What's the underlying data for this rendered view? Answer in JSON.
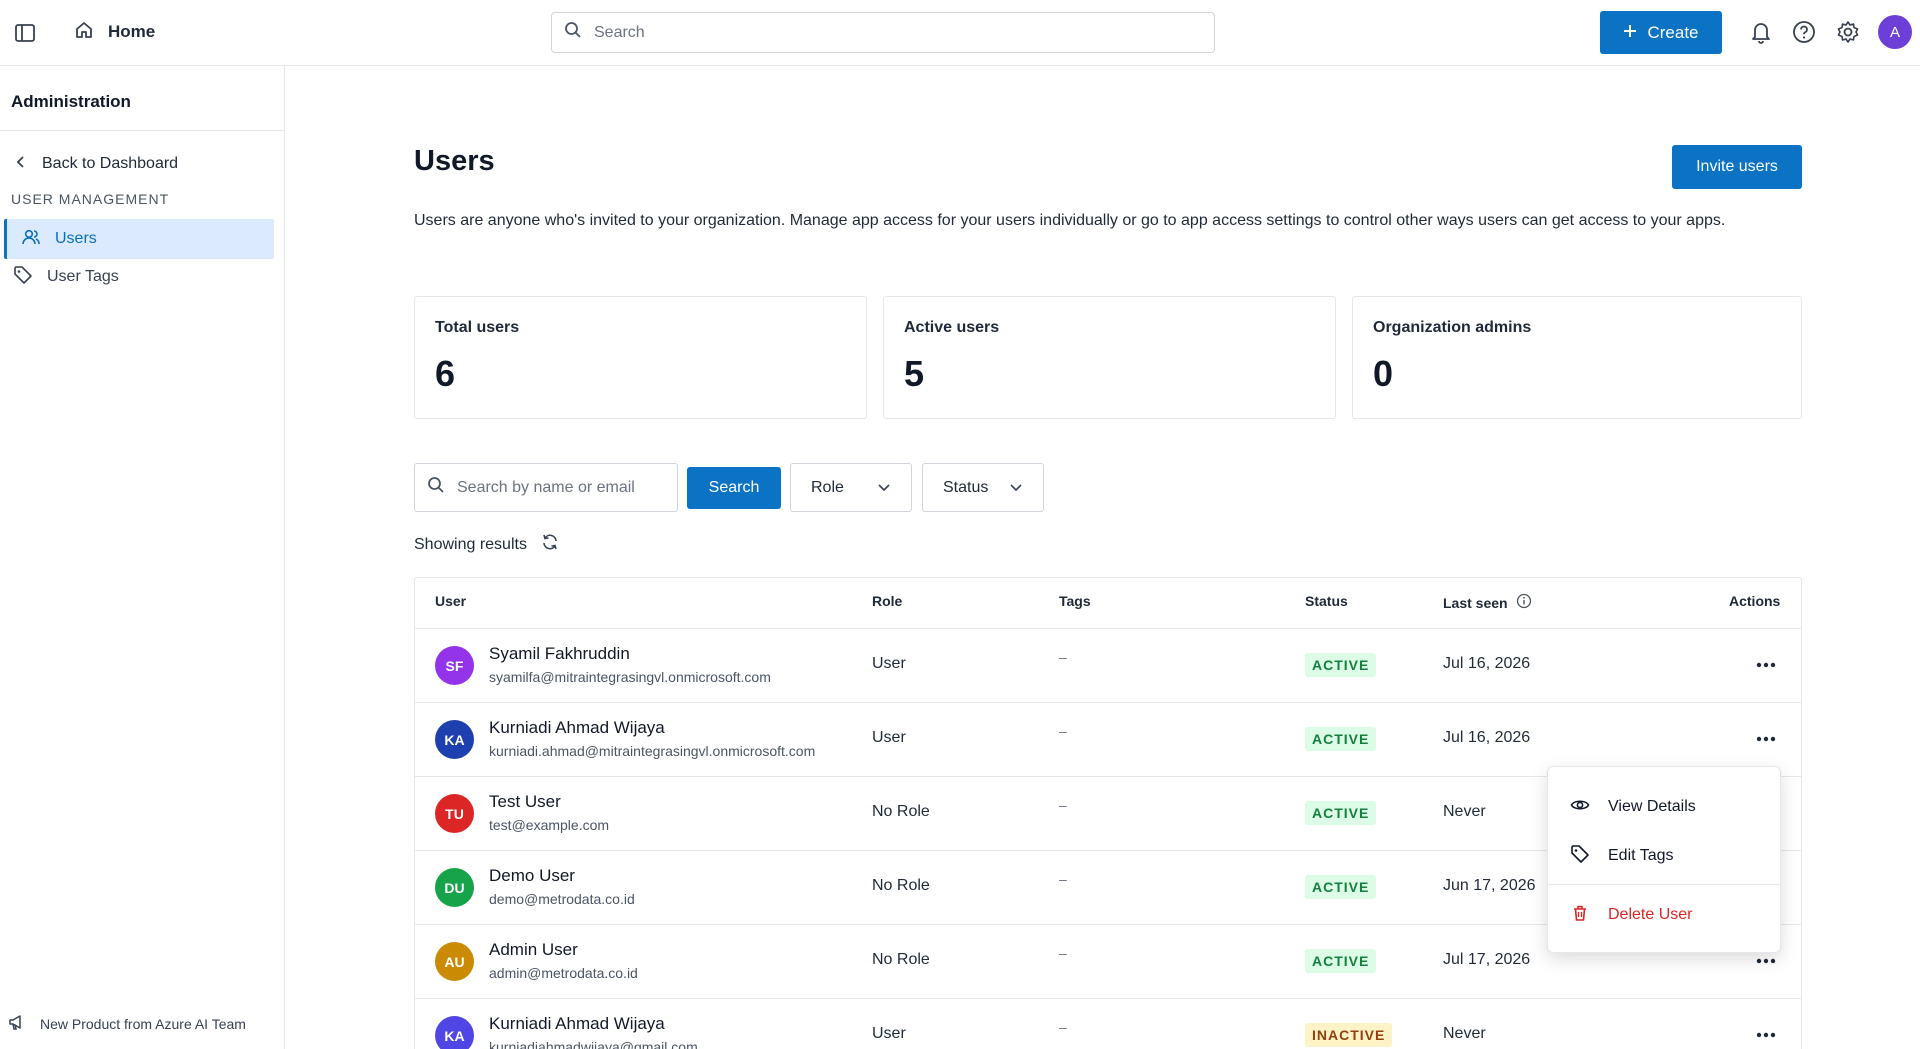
{
  "topbar": {
    "home_label": "Home",
    "search_placeholder": "Search",
    "create_label": "Create",
    "avatar_initial": "A"
  },
  "sidebar": {
    "title": "Administration",
    "back_label": "Back to Dashboard",
    "section_label": "USER MANAGEMENT",
    "items": [
      {
        "label": "Users",
        "icon": "users-icon",
        "active": true
      },
      {
        "label": "User Tags",
        "icon": "tag-icon",
        "active": false
      }
    ],
    "footer_label": "New Product from Azure AI Team"
  },
  "page": {
    "title": "Users",
    "invite_label": "Invite users",
    "description": "Users are anyone who's invited to your organization. Manage app access for your users individually or go to app access settings to control other ways users can get access to your apps."
  },
  "stats": [
    {
      "label": "Total users",
      "value": "6"
    },
    {
      "label": "Active users",
      "value": "5"
    },
    {
      "label": "Organization admins",
      "value": "0"
    }
  ],
  "filters": {
    "search_placeholder": "Search by name or email",
    "search_button": "Search",
    "role_label": "Role",
    "status_label": "Status",
    "results_label": "Showing results"
  },
  "table": {
    "columns": [
      "User",
      "Role",
      "Tags",
      "Status",
      "Last seen",
      "Actions"
    ],
    "rows": [
      {
        "initials": "SF",
        "avatar_color": "#9333ea",
        "name": "Syamil Fakhruddin",
        "email": "syamilfa@mitraintegrasingvl.onmicrosoft.com",
        "role": "User",
        "tags": "–",
        "status": "ACTIVE",
        "last_seen": "Jul 16, 2026"
      },
      {
        "initials": "KA",
        "avatar_color": "#1e40af",
        "name": "Kurniadi Ahmad Wijaya",
        "email": "kurniadi.ahmad@mitraintegrasingvl.onmicrosoft.com",
        "role": "User",
        "tags": "–",
        "status": "ACTIVE",
        "last_seen": "Jul 16, 2026"
      },
      {
        "initials": "TU",
        "avatar_color": "#dc2626",
        "name": "Test User",
        "email": "test@example.com",
        "role": "No Role",
        "tags": "–",
        "status": "ACTIVE",
        "last_seen": "Never"
      },
      {
        "initials": "DU",
        "avatar_color": "#16a34a",
        "name": "Demo User",
        "email": "demo@metrodata.co.id",
        "role": "No Role",
        "tags": "–",
        "status": "ACTIVE",
        "last_seen": "Jun 17, 2026"
      },
      {
        "initials": "AU",
        "avatar_color": "#ca8a04",
        "name": "Admin User",
        "email": "admin@metrodata.co.id",
        "role": "No Role",
        "tags": "–",
        "status": "ACTIVE",
        "last_seen": "Jul 17, 2026"
      },
      {
        "initials": "KA",
        "avatar_color": "#4f46e5",
        "name": "Kurniadi Ahmad Wijaya",
        "email": "kurniadiahmadwijaya@gmail.com",
        "role": "User",
        "tags": "–",
        "status": "INACTIVE",
        "last_seen": "Never"
      }
    ]
  },
  "context_menu": {
    "items": [
      {
        "label": "View Details",
        "icon": "eye-icon"
      },
      {
        "label": "Edit Tags",
        "icon": "tag-icon"
      },
      {
        "label": "Delete User",
        "icon": "trash-icon"
      }
    ]
  },
  "colors": {
    "primary": "#0b72c4",
    "active_badge_bg": "#dcfce7",
    "active_badge_text": "#15803d",
    "danger": "#dc2626"
  }
}
